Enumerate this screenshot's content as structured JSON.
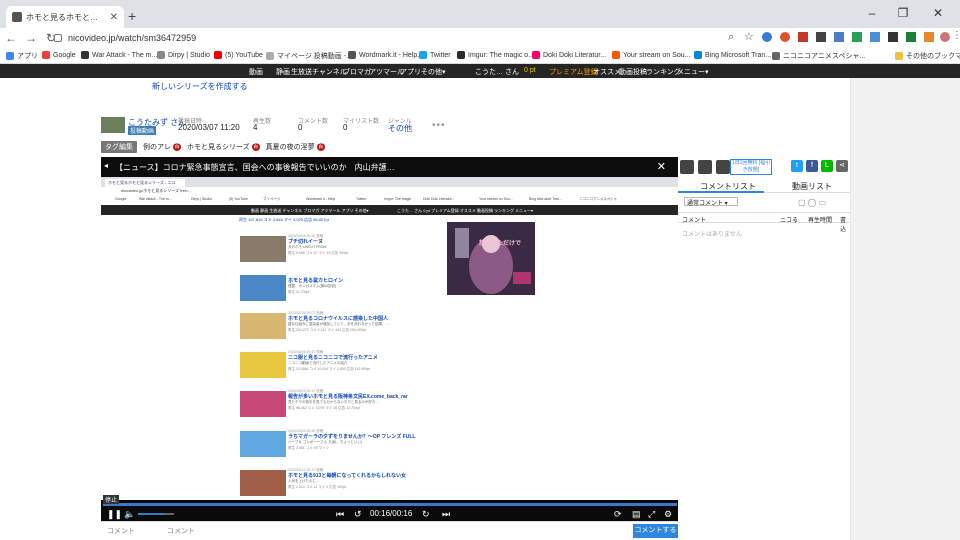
{
  "browser": {
    "tab_title": "ホモと見るホモと見るシリーズ - ニコニ",
    "url": "nicovideo.jp/watch/sm36472959",
    "bookmarks": [
      "アプリ",
      "Google",
      "War Attack - The m...",
      "Dirpy | Studio",
      "(5) YouTube",
      "マイページ 投稿動画 -...",
      "Wordmark.it - Help...",
      "Twitter",
      "Imgur: The magic o...",
      "Doki Doki Literatur...",
      "Your stream on Sou...",
      "Bing Microsoft Tran...",
      "ニコニコアニメスペシャ...",
      "その他のブックマーク"
    ]
  },
  "nico_nav": {
    "items": [
      "動画",
      "静画",
      "生放送",
      "チャンネル",
      "ブロマガ",
      "アツマール",
      "アプリ",
      "その他▾"
    ],
    "user": "こうた… さん",
    "points": "0 pt",
    "premium": "プレミアム登録",
    "right_items": [
      "オススメ",
      "動画投稿",
      "ランキング",
      "メニュー▾"
    ]
  },
  "page": {
    "create_series": "新しいシリーズを作成する",
    "uploader": "こうたみず さん",
    "uploader_badge": "投稿動画",
    "meta": [
      {
        "label": "投稿日時",
        "value": "2020/03/07 11:20"
      },
      {
        "label": "再生数",
        "value": "4"
      },
      {
        "label": "コメント数",
        "value": "0"
      },
      {
        "label": "マイリスト数",
        "value": "0"
      },
      {
        "label": "ジャンル",
        "value": "その他"
      }
    ],
    "more": "•••",
    "tag_label": "タグ編集",
    "tags": [
      {
        "name": "例のアレ",
        "badge": "百"
      },
      {
        "name": "ホモと見るシリーズ",
        "badge": "百"
      },
      {
        "name": "真夏の夜の淫夢",
        "badge": "百"
      }
    ]
  },
  "player": {
    "title": "【ニュース】コロナ緊急事態宣言、国会への事後報告でいいのか　内山弁護…",
    "stop_label": "停止",
    "time": "00:16/00:16",
    "comment_label": "コメント",
    "comment_placeholder": "コメント",
    "comment_button": "コメントする",
    "inner": {
      "tab": "ホモと見るホモと見るシリーズ - ニコ",
      "url": "nicovideo.jp/ホモと見るシリーズ?ref=...",
      "bookmarks": [
        "Google",
        "War Attack - The m...",
        "Dirpy | Studio",
        "(5) YouTube",
        "マイページ",
        "Wordmark.it - Help",
        "Twitter",
        "Imgur: The magic",
        "Doki Doki Literatur...",
        "Your stream on Sou...",
        "Bing Microsoft Tran...",
        "ニコニコアニメスペシャ"
      ],
      "nav": "動画 静画 生放送 チャンネル ブロマガ アツマール アプリ その他▾",
      "nav_right": "こうた… さん  0 pt  プレミアム登録  オススメ  動画投稿  ランキング  メニュー▾",
      "top_stats": "再生 167,816   コメ 3,846   マイ 4,925   広告 56,607pt",
      "videos": [
        {
          "date": "2020/03/06 20:42 投稿",
          "title": "ブチ切れイーヌ",
          "desc": "犬のホモ UNCUT FROM",
          "stats": "再生 5,568  コメ 57  マイ 19  広告 500pt",
          "color": "#8a7a6a"
        },
        {
          "date": "",
          "title": "ホモと見る鼠カヒロイン",
          "desc": "連載：カンガスホム(第64回目)",
          "stats": "再生 11,700pt",
          "color": "#4a88c8"
        },
        {
          "date": "2020/02/26 20:07 投稿",
          "title": "ホモと見るコロナウイルスに感染した中国人",
          "desc": "雑な仕組みに感染者が増加していて、手を洗わなかった結果、…",
          "stats": "再生 204,273  コメ 2,120  マイ 443  広告 259,300pt",
          "color": "#d8b870"
        },
        {
          "date": "2020/02/26 20:47 投稿",
          "title": "ニコ厨と見るニコニコで流行ったアニメ",
          "desc": "ニコニコ動画で流行したアニメの紹介",
          "stats": "再生 113,884  コメ 10,934  マイ 1,800  広告 142,900pt",
          "color": "#e8c840"
        },
        {
          "date": "2020/02/23 20:17 投稿",
          "title": "報告が多いホモと見る阪神条文民EX.come_back_rar",
          "desc": "見たホモの割引を見ても分からないホモと見るのが好き…",
          "stats": "再生 98,462  コメ 3,079  マイ 26  広告 12,700pt",
          "color": "#c84878"
        },
        {
          "date": "2020/02/22 20:40 投稿",
          "title": "ラちマガーラの夕ずをりませんか？～OP フレンズ FULL",
          "desc": "ハーブ＆ ゴンボーーさん 夫(私、ちょっといい)",
          "stats": "再生 2,361  コメ 59  マイ 0",
          "color": "#60a8e0"
        },
        {
          "date": "2020/02/12 20:17 投稿",
          "title": "ホモと見る913と毎朝になってくれるかもしれない女",
          "desc": "人気を上げたのに…",
          "stats": "再生 2,314  コメ 11  マイ 2  広告 100pt",
          "color": "#a06048"
        }
      ],
      "poster_title": "想像しただけで"
    }
  },
  "side_panel": {
    "campaign": "1日1回無料 [福引き放題]",
    "share": [
      "Twitter",
      "Facebook",
      "LINE",
      "Share"
    ],
    "tab_comments": "コメントリスト",
    "tab_related": "動画リスト",
    "select_value": "通常コメント",
    "columns": [
      "コメント",
      "ニコる",
      "再生時間",
      "書込"
    ],
    "empty_text": "コメントはありません"
  },
  "colors": {
    "nico_bar": "#252525",
    "link_blue": "#0d45b4",
    "accent_blue": "#2e86de",
    "tag_badge": "#b71c1c"
  }
}
